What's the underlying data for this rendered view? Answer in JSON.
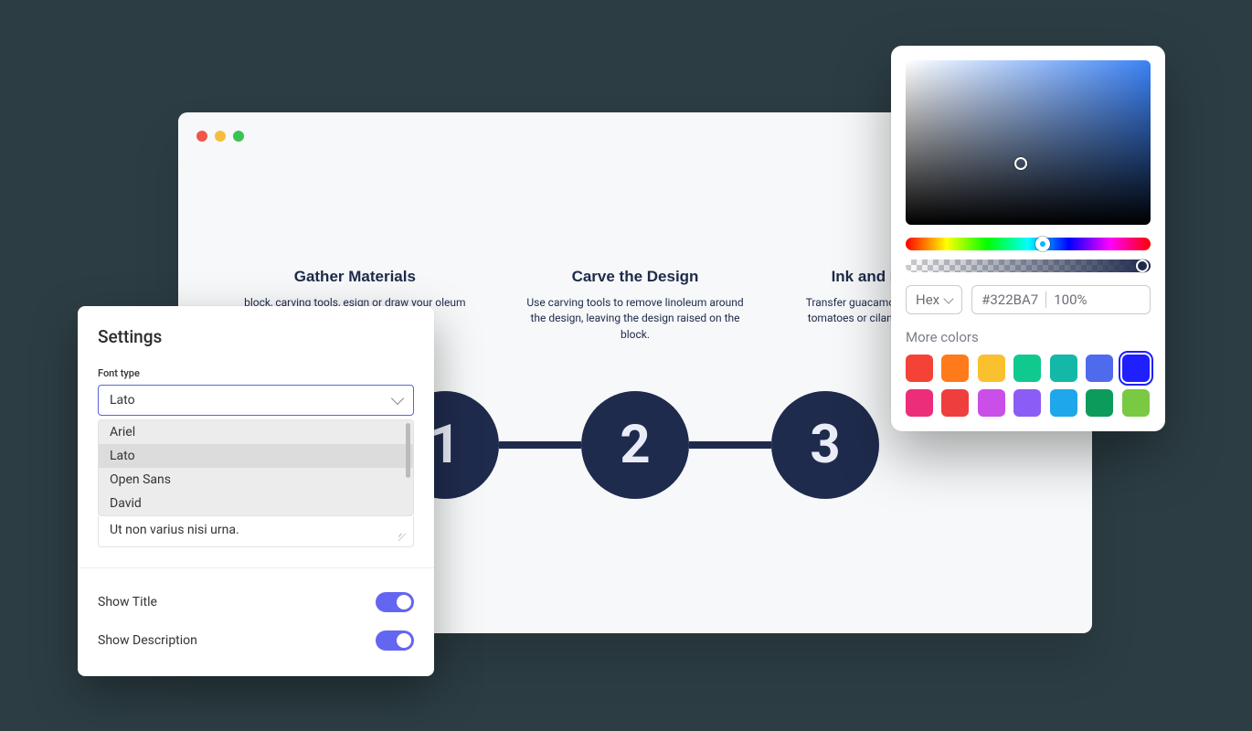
{
  "canvas": {
    "steps": [
      {
        "title": "Gather Materials",
        "description": "block, carving tools, esign or draw your oleum block.",
        "number": "1"
      },
      {
        "title": "Carve the Design",
        "description": "Use carving tools to remove linoleum around the design, leaving the design raised on the block.",
        "number": "2"
      },
      {
        "title": "Ink and Print the Desig",
        "description": "Transfer guacamole to serving d garnish with tomatoes or cilantro serve with chips or as a topping",
        "number": "3"
      }
    ]
  },
  "settings": {
    "title": "Settings",
    "font_type_label": "Font type",
    "selected_font": "Lato",
    "font_options": [
      "Ariel",
      "Lato",
      "Open Sans",
      "David"
    ],
    "textarea_value": "Ut non varius nisi urna.",
    "show_title_label": "Show Title",
    "show_title_on": true,
    "show_description_label": "Show Description",
    "show_description_on": true
  },
  "picker": {
    "mode_label": "Hex",
    "hex_value": "#322BA7",
    "alpha_value": "100%",
    "more_colors_label": "More colors",
    "swatches": [
      {
        "color": "#f44336",
        "selected": false
      },
      {
        "color": "#ff7a1a",
        "selected": false
      },
      {
        "color": "#fbc02d",
        "selected": false
      },
      {
        "color": "#10c98e",
        "selected": false
      },
      {
        "color": "#14b8a6",
        "selected": false
      },
      {
        "color": "#4f6bed",
        "selected": false
      },
      {
        "color": "#1f1fff",
        "selected": true
      },
      {
        "color": "#ec2e7a",
        "selected": false
      },
      {
        "color": "#ef3e3e",
        "selected": false
      },
      {
        "color": "#c94fe8",
        "selected": false
      },
      {
        "color": "#8b5cf6",
        "selected": false
      },
      {
        "color": "#1ea7ea",
        "selected": false
      },
      {
        "color": "#0d9b5b",
        "selected": false
      },
      {
        "color": "#7ac943",
        "selected": false
      }
    ]
  }
}
